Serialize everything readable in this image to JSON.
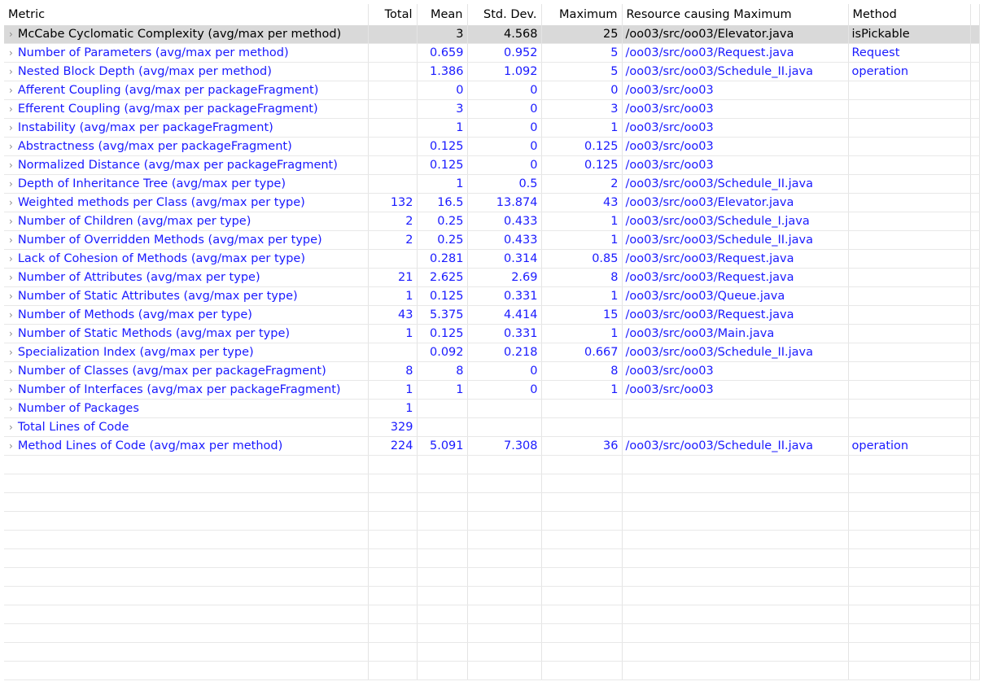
{
  "columns": [
    "Metric",
    "Total",
    "Mean",
    "Std. Dev.",
    "Maximum",
    "Resource causing Maximum",
    "Method"
  ],
  "rows": [
    [
      "McCabe Cyclomatic Complexity (avg/max per method)",
      "",
      "3",
      "4.568",
      "25",
      "/oo03/src/oo03/Elevator.java",
      "isPickable"
    ],
    [
      "Number of Parameters (avg/max per method)",
      "",
      "0.659",
      "0.952",
      "5",
      "/oo03/src/oo03/Request.java",
      "Request"
    ],
    [
      "Nested Block Depth (avg/max per method)",
      "",
      "1.386",
      "1.092",
      "5",
      "/oo03/src/oo03/Schedule_II.java",
      "operation"
    ],
    [
      "Afferent Coupling (avg/max per packageFragment)",
      "",
      "0",
      "0",
      "0",
      "/oo03/src/oo03",
      ""
    ],
    [
      "Efferent Coupling (avg/max per packageFragment)",
      "",
      "3",
      "0",
      "3",
      "/oo03/src/oo03",
      ""
    ],
    [
      "Instability (avg/max per packageFragment)",
      "",
      "1",
      "0",
      "1",
      "/oo03/src/oo03",
      ""
    ],
    [
      "Abstractness (avg/max per packageFragment)",
      "",
      "0.125",
      "0",
      "0.125",
      "/oo03/src/oo03",
      ""
    ],
    [
      "Normalized Distance (avg/max per packageFragment)",
      "",
      "0.125",
      "0",
      "0.125",
      "/oo03/src/oo03",
      ""
    ],
    [
      "Depth of Inheritance Tree (avg/max per type)",
      "",
      "1",
      "0.5",
      "2",
      "/oo03/src/oo03/Schedule_II.java",
      ""
    ],
    [
      "Weighted methods per Class (avg/max per type)",
      "132",
      "16.5",
      "13.874",
      "43",
      "/oo03/src/oo03/Elevator.java",
      ""
    ],
    [
      "Number of Children (avg/max per type)",
      "2",
      "0.25",
      "0.433",
      "1",
      "/oo03/src/oo03/Schedule_I.java",
      ""
    ],
    [
      "Number of Overridden Methods (avg/max per type)",
      "2",
      "0.25",
      "0.433",
      "1",
      "/oo03/src/oo03/Schedule_II.java",
      ""
    ],
    [
      "Lack of Cohesion of Methods (avg/max per type)",
      "",
      "0.281",
      "0.314",
      "0.85",
      "/oo03/src/oo03/Request.java",
      ""
    ],
    [
      "Number of Attributes (avg/max per type)",
      "21",
      "2.625",
      "2.69",
      "8",
      "/oo03/src/oo03/Request.java",
      ""
    ],
    [
      "Number of Static Attributes (avg/max per type)",
      "1",
      "0.125",
      "0.331",
      "1",
      "/oo03/src/oo03/Queue.java",
      ""
    ],
    [
      "Number of Methods (avg/max per type)",
      "43",
      "5.375",
      "4.414",
      "15",
      "/oo03/src/oo03/Request.java",
      ""
    ],
    [
      "Number of Static Methods (avg/max per type)",
      "1",
      "0.125",
      "0.331",
      "1",
      "/oo03/src/oo03/Main.java",
      ""
    ],
    [
      "Specialization Index (avg/max per type)",
      "",
      "0.092",
      "0.218",
      "0.667",
      "/oo03/src/oo03/Schedule_II.java",
      ""
    ],
    [
      "Number of Classes (avg/max per packageFragment)",
      "8",
      "8",
      "0",
      "8",
      "/oo03/src/oo03",
      ""
    ],
    [
      "Number of Interfaces (avg/max per packageFragment)",
      "1",
      "1",
      "0",
      "1",
      "/oo03/src/oo03",
      ""
    ],
    [
      "Number of Packages",
      "1",
      "",
      "",
      "",
      "",
      ""
    ],
    [
      "Total Lines of Code",
      "329",
      "",
      "",
      "",
      "",
      ""
    ],
    [
      "Method Lines of Code (avg/max per method)",
      "224",
      "5.091",
      "7.308",
      "36",
      "/oo03/src/oo03/Schedule_II.java",
      "operation"
    ]
  ],
  "selected_row": 0,
  "icons": {
    "expand": "chevron-right-icon"
  }
}
